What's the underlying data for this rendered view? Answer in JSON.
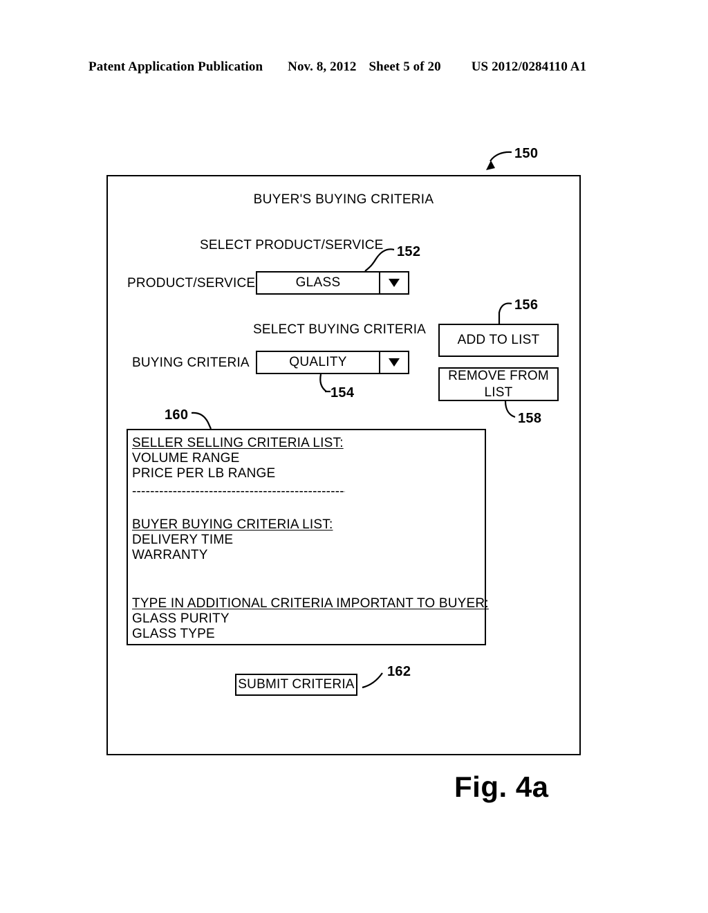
{
  "header": {
    "publication": "Patent Application Publication",
    "date": "Nov. 8, 2012",
    "sheet": "Sheet 5 of 20",
    "patent_number": "US 2012/0284110 A1"
  },
  "figure": {
    "caption": "Fig. 4a",
    "screen_title": "BUYER'S BUYING CRITERIA"
  },
  "product_section": {
    "section_label": "SELECT PRODUCT/SERVICE",
    "row_label": "PRODUCT/SERVICE",
    "selected_value": "GLASS",
    "arrow_icon": "dropdown-arrow-down"
  },
  "criteria_section": {
    "section_label": "SELECT BUYING CRITERIA",
    "row_label": "BUYING CRITERIA",
    "selected_value": "QUALITY",
    "arrow_icon": "dropdown-arrow-down"
  },
  "buttons": {
    "add_to_list": "ADD TO LIST",
    "remove_from_list": "REMOVE FROM LIST",
    "submit_criteria": "SUBMIT CRITERIA"
  },
  "criteria_list": {
    "seller_heading": "SELLER SELLING CRITERIA LIST:",
    "seller_items": [
      "VOLUME RANGE",
      "PRICE PER LB RANGE"
    ],
    "separator": "-------------------------------------------------",
    "buyer_heading": "BUYER BUYING CRITERIA LIST:",
    "buyer_items": [
      "DELIVERY TIME",
      "WARRANTY"
    ],
    "additional_heading": "TYPE IN ADDITIONAL CRITERIA IMPORTANT TO BUYER:",
    "additional_items": [
      "GLASS PURITY",
      "GLASS TYPE"
    ]
  },
  "reference_numerals": {
    "screen": "150",
    "product_dropdown": "152",
    "criteria_dropdown": "154",
    "add_button": "156",
    "remove_button": "158",
    "list_box": "160",
    "submit_button": "162"
  },
  "colors": {
    "ink": "#000000",
    "paper": "#ffffff"
  }
}
